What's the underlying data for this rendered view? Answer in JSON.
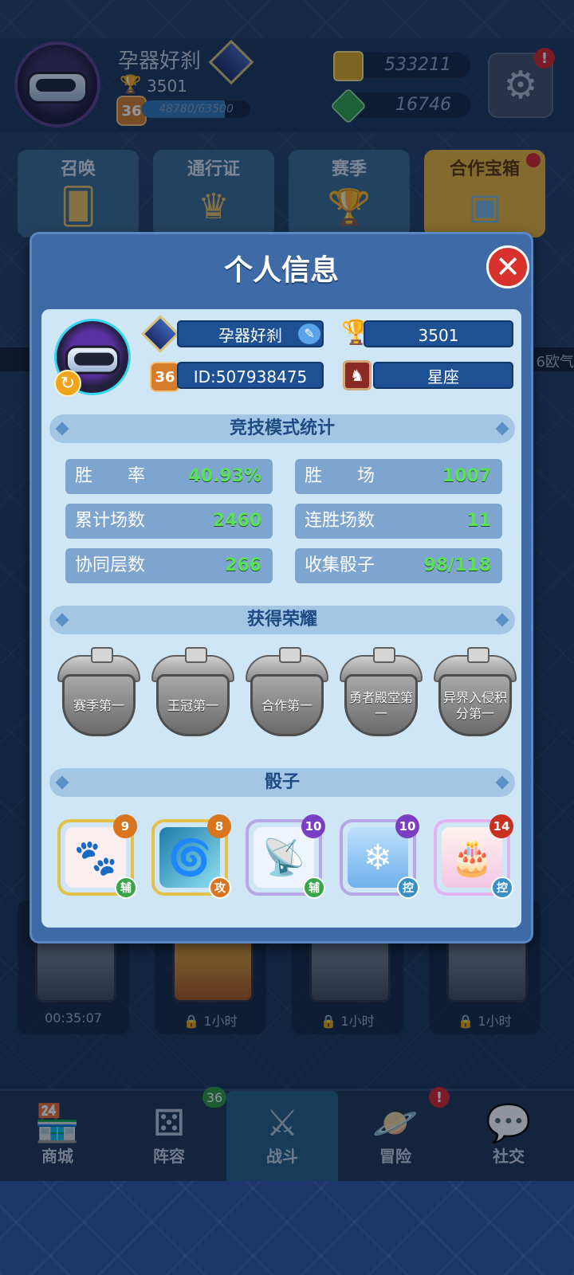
{
  "header": {
    "player_name": "孕器好刹",
    "trophies": "3501",
    "level": "36",
    "xp_text": "48780/63500",
    "xp_fraction": 0.768,
    "gold": "533211",
    "gems": "16746",
    "settings_alert": "!"
  },
  "menu": [
    {
      "label": "召唤",
      "icon": "cards-icon"
    },
    {
      "label": "通行证",
      "icon": "crown-badge-icon"
    },
    {
      "label": "赛季",
      "icon": "trophy-icon"
    },
    {
      "label": "合作宝箱",
      "icon": "chest-icon"
    }
  ],
  "side_strip_text": "6欧气",
  "chests": [
    {
      "label": "00:35:07"
    },
    {
      "label": "1小时"
    },
    {
      "label": "1小时"
    },
    {
      "label": "1小时"
    }
  ],
  "nav": {
    "items": [
      "商城",
      "阵容",
      "战斗",
      "冒险",
      "社交"
    ],
    "lineup_badge": "36",
    "adventure_alert": "!"
  },
  "modal": {
    "title": "个人信息",
    "close_glyph": "✕",
    "name": "孕器好刹",
    "trophies": "3501",
    "level": "36",
    "id_text": "ID:507938475",
    "constellation": "星座",
    "stats_title": "竞技模式统计",
    "stats": [
      {
        "label": "胜　　率",
        "value": "40.93%"
      },
      {
        "label": "胜　　场",
        "value": "1007"
      },
      {
        "label": "累计场数",
        "value": "2460"
      },
      {
        "label": "连胜场数",
        "value": "11"
      },
      {
        "label": "协同层数",
        "value": "266"
      },
      {
        "label": "收集骰子",
        "value": "98/118"
      }
    ],
    "honors_title": "获得荣耀",
    "honors": [
      "赛季第一",
      "王冠第一",
      "合作第一",
      "勇者殿堂第一",
      "异界入侵积分第一"
    ],
    "dice_title": "骰子",
    "dice": [
      {
        "level": "9",
        "tag": "辅",
        "icon": "paw-icon"
      },
      {
        "level": "8",
        "tag": "攻",
        "icon": "vortex-icon"
      },
      {
        "level": "10",
        "tag": "辅",
        "icon": "signal-icon"
      },
      {
        "level": "10",
        "tag": "控",
        "icon": "snowflake-icon"
      },
      {
        "level": "14",
        "tag": "控",
        "icon": "cake-icon"
      }
    ]
  },
  "colors": {
    "modal_bg": "#3e6aa8",
    "panel_bg": "#cfe6f7",
    "stat_value": "#5ce05c",
    "close_red": "#d8322d"
  }
}
